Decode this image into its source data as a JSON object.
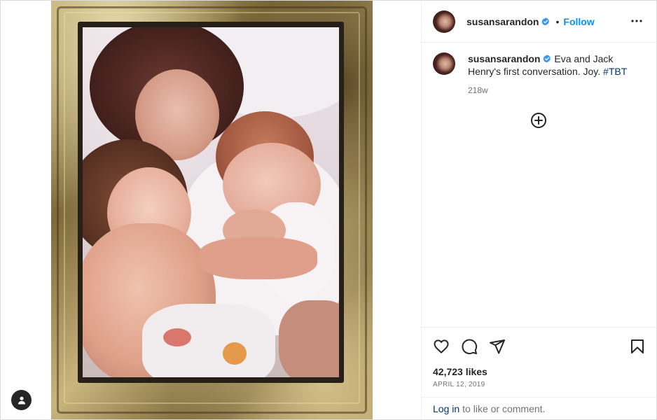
{
  "post": {
    "author": "susansarandon",
    "follow_label": "Follow",
    "separator": "•",
    "caption_text": " Eva and Jack Henry's first conversation. Joy. ",
    "hashtag": "#TBT",
    "time_ago": "218w",
    "likes": "42,723 likes",
    "date": "APRIL 12, 2019",
    "login_link": "Log in",
    "login_suffix": "to like or comment."
  },
  "icons": {
    "verified": "verified-badge-icon",
    "more": "more-options-icon",
    "load_more": "plus-circle-icon",
    "like": "heart-icon",
    "comment": "comment-icon",
    "share": "paper-plane-icon",
    "save": "bookmark-icon",
    "profile": "user-icon"
  },
  "colors": {
    "accent": "#0095f6",
    "link": "#00376b",
    "muted": "#737373",
    "text": "#262626",
    "border": "#efefef"
  }
}
